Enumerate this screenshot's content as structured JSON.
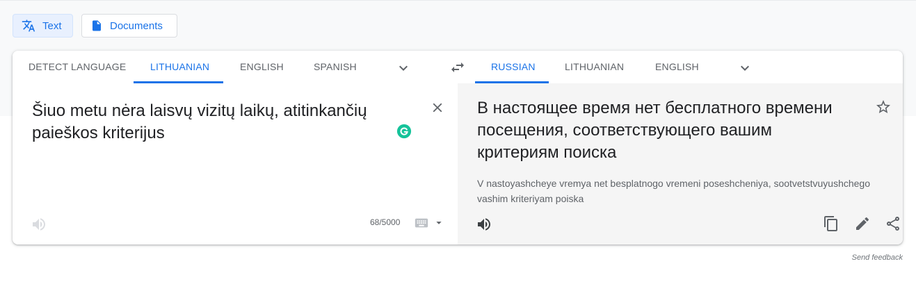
{
  "modes": {
    "text_label": "Text",
    "documents_label": "Documents"
  },
  "source": {
    "languages": [
      "Detect language",
      "Lithuanian",
      "English",
      "Spanish"
    ],
    "active_language": "Lithuanian",
    "text": "Šiuo metu nėra laisvų vizitų laikų, atitinkančių paieškos kriterijus",
    "char_count": "68/5000"
  },
  "target": {
    "languages": [
      "Russian",
      "Lithuanian",
      "English"
    ],
    "active_language": "Russian",
    "text": "В настоящее время нет бесплатного времени посещения, соответствующего вашим критериям поиска",
    "transliteration": "V nastoyashcheye vremya net besplatnogo vremeni poseshcheniya, sootvetstvuyushchego vashim kriteriyam poiska"
  },
  "footer": {
    "feedback_label": "Send feedback"
  },
  "icons": {
    "text_mode": "translate-icon",
    "documents_mode": "document-icon",
    "swap": "swap-languages-icon",
    "expand": "chevron-down-icon",
    "clear": "close-icon",
    "grammarly": "grammarly-icon",
    "listen": "speaker-icon",
    "keyboard": "keyboard-icon",
    "star": "star-icon",
    "copy": "copy-icon",
    "edit": "pencil-icon",
    "share": "share-icon"
  },
  "colors": {
    "accent": "#1a73e8",
    "grammarly": "#15c39a",
    "target_panel_bg": "#f5f5f5"
  }
}
